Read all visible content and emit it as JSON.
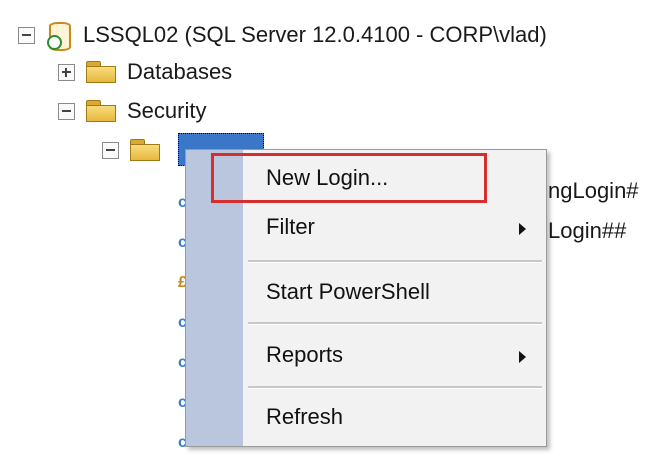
{
  "tree": {
    "server_label": "LSSQL02 (SQL Server 12.0.4100 - CORP\\vlad)",
    "databases_label": "Databases",
    "security_label": "Security",
    "partial_items": [
      "ngLogin#",
      "Login##"
    ]
  },
  "context_menu": {
    "items": [
      {
        "label": "New Login...",
        "highlighted": true
      },
      {
        "label": "Filter",
        "submenu": true
      },
      {
        "label": "Start PowerShell"
      },
      {
        "label": "Reports",
        "submenu": true
      },
      {
        "label": "Refresh"
      }
    ]
  },
  "colors": {
    "highlight_box": "#d62d2d",
    "menu_gutter": "#b9c6dd",
    "selected_node": "#3b77c9"
  }
}
